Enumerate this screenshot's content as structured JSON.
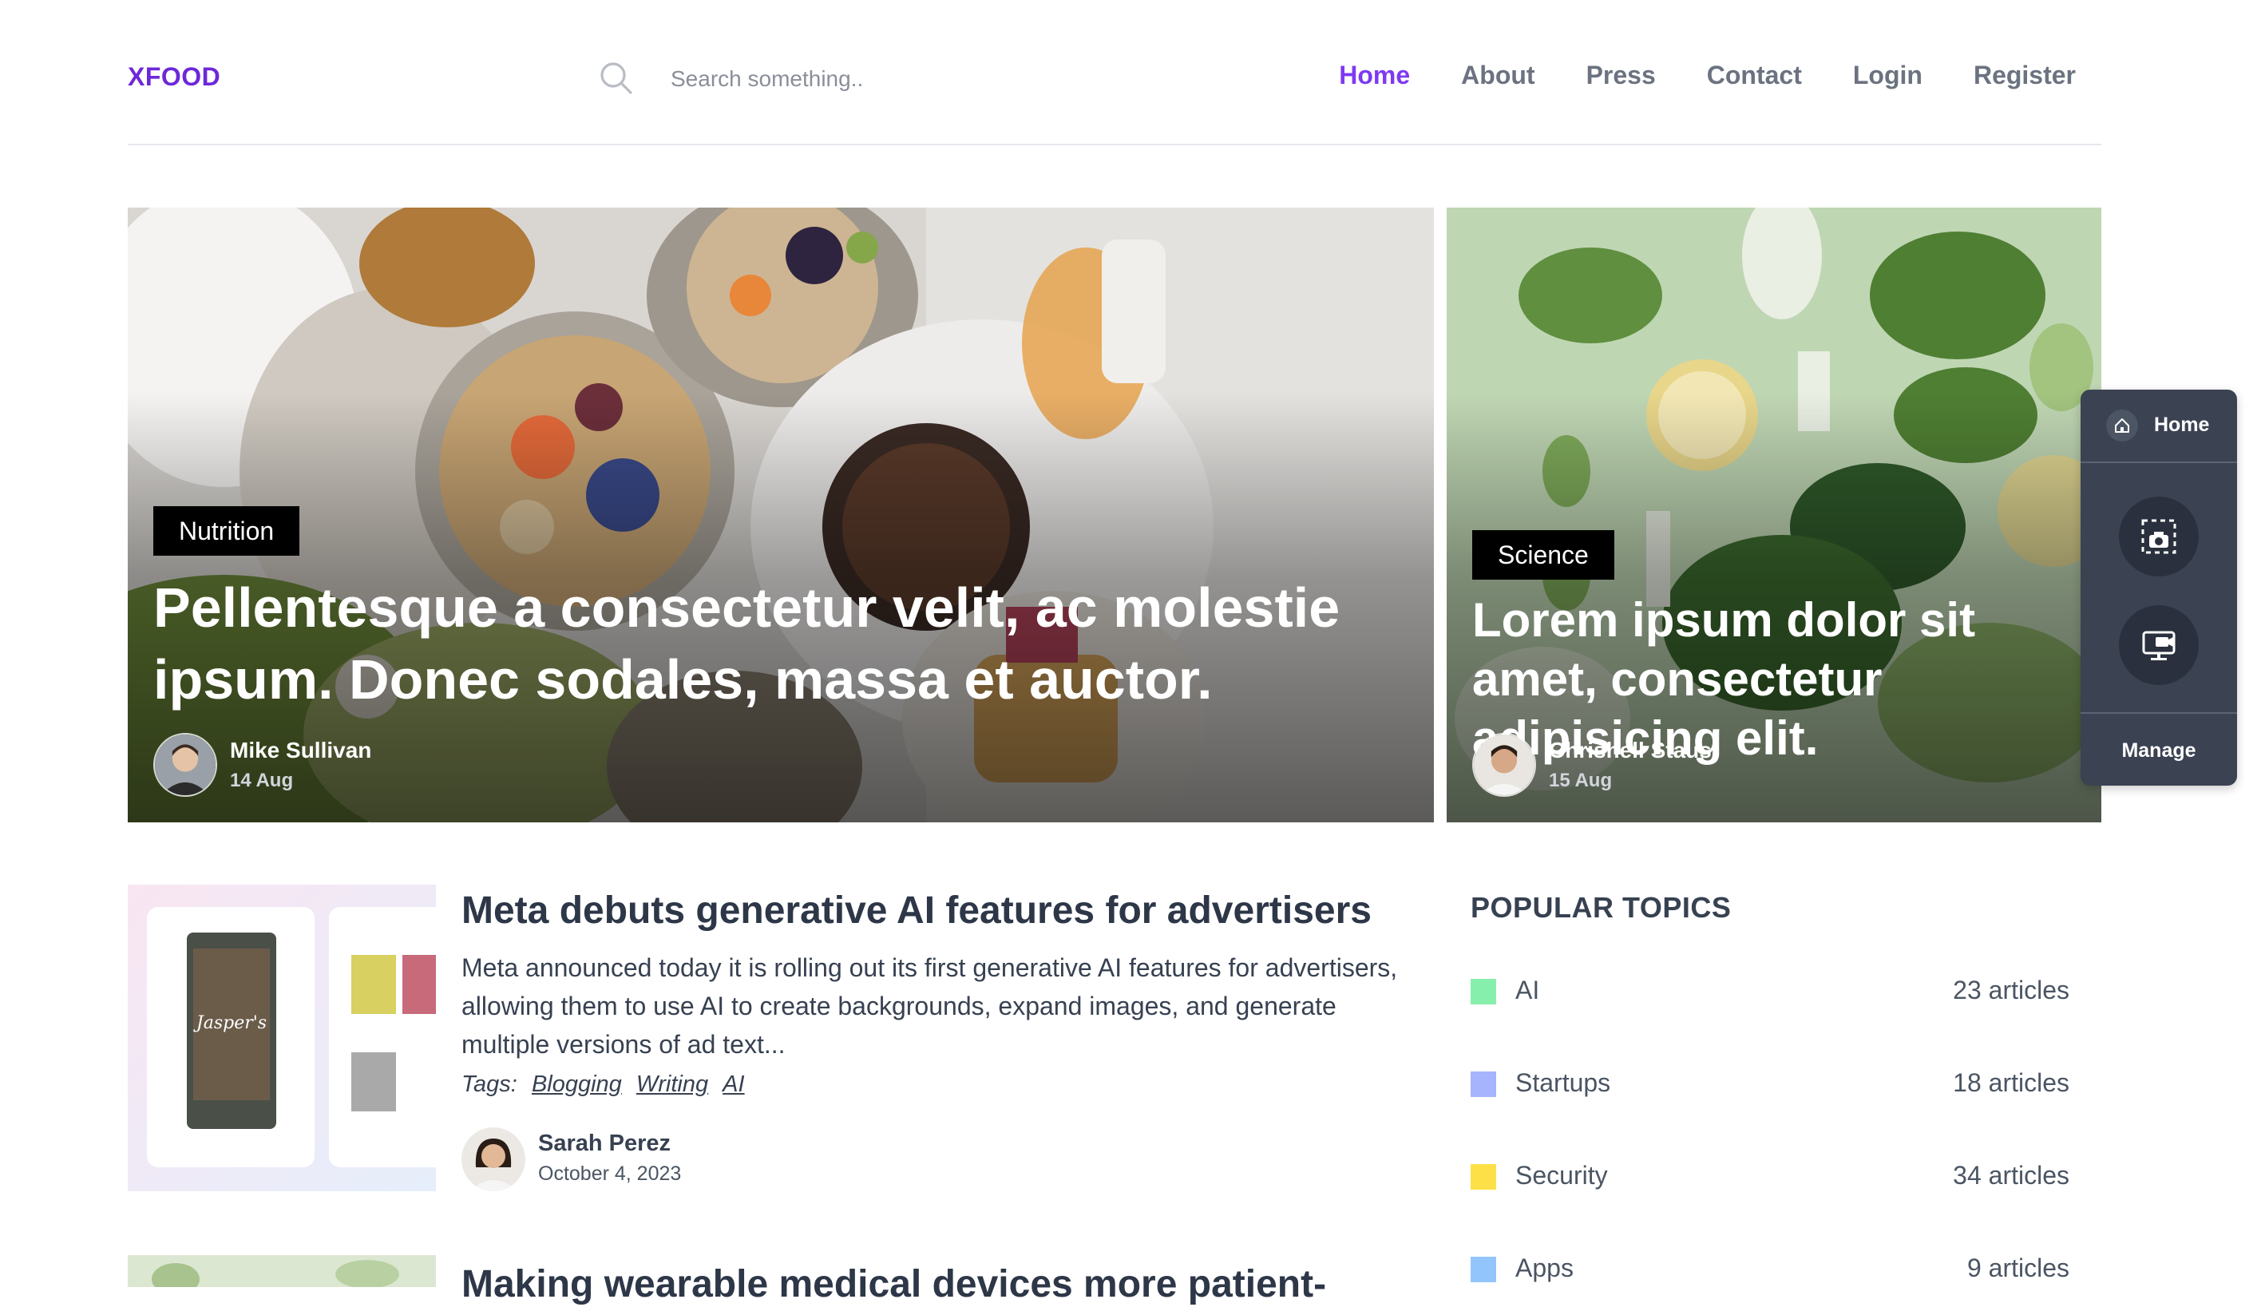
{
  "header": {
    "logo": "XFOOD",
    "search_placeholder": "Search something..",
    "nav": [
      "Home",
      "About",
      "Press",
      "Contact",
      "Login",
      "Register"
    ],
    "active_nav": "Home"
  },
  "hero_main": {
    "category": "Nutrition",
    "title": "Pellentesque a consectetur velit, ac molestie ipsum. Donec sodales, massa et auctor.",
    "author": "Mike Sullivan",
    "date": "14 Aug"
  },
  "hero_side": {
    "category": "Science",
    "title": "Lorem ipsum dolor sit amet, consectetur adipisicing elit.",
    "author": "Chrishell Staus",
    "date": "15 Aug"
  },
  "toolbar": {
    "home_label": "Home",
    "manage_label": "Manage"
  },
  "article": {
    "title": "Meta debuts generative AI features for advertisers",
    "excerpt": "Meta announced today it is rolling out its first generative AI features for advertisers, allowing them to use AI to create backgrounds, expand images, and generate multiple versions of ad text...",
    "tags_label": "Tags:",
    "tags": [
      "Blogging",
      "Writing",
      "AI"
    ],
    "author": "Sarah Perez",
    "date": "October 4, 2023",
    "thumb_text": "Jasper's"
  },
  "article2": {
    "title": "Making wearable medical devices more patient-"
  },
  "topics": {
    "heading": "POPULAR TOPICS",
    "items": [
      {
        "name": "AI",
        "count": "23 articles",
        "color": "#86efac"
      },
      {
        "name": "Startups",
        "count": "18 articles",
        "color": "#a5b4fc"
      },
      {
        "name": "Security",
        "count": "34 articles",
        "color": "#fde047"
      },
      {
        "name": "Apps",
        "count": "9 articles",
        "color": "#93c5fd"
      }
    ]
  },
  "colors": {
    "brand": "#6d28d9",
    "nav_active": "#7e3af2",
    "toolbar_bg": "#3b4252"
  }
}
